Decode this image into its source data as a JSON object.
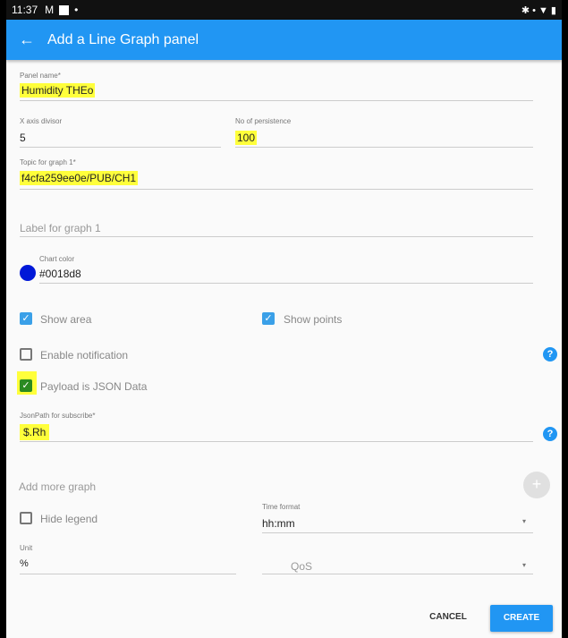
{
  "status": {
    "time": "11:37",
    "mail_glyph": "M",
    "dot": "•",
    "right": "✱ • ▼ ▮"
  },
  "appbar": {
    "back": "←",
    "title": "Add a Line Graph panel"
  },
  "panel_name": {
    "label": "Panel name",
    "required": "*",
    "value": "Humidity THEo"
  },
  "x_axis": {
    "label": "X axis divisor",
    "value": "5"
  },
  "persistence": {
    "label": "No of persistence",
    "value": "100"
  },
  "topic": {
    "label": "Topic for graph 1",
    "required": "*",
    "value": "f4cfa259ee0e/PUB/CH1"
  },
  "graph_label": {
    "placeholder": "Label for graph 1"
  },
  "chart_color": {
    "label": "Chart color",
    "value": "#0018d8",
    "swatch": "#0018d8"
  },
  "checkboxes": {
    "show_area": "Show area",
    "show_points": "Show points",
    "enable_notification": "Enable notification",
    "payload_json": "Payload is JSON Data",
    "hide_legend": "Hide legend"
  },
  "jsonpath": {
    "label": "JsonPath for subscribe",
    "required": "*",
    "value": "$.Rh"
  },
  "add_more": {
    "label": "Add more graph",
    "icon": "+"
  },
  "time_format": {
    "label": "Time format",
    "value": "hh:mm"
  },
  "unit": {
    "label": "Unit",
    "value": "%"
  },
  "qos": {
    "placeholder": "QoS"
  },
  "help_icon": "?",
  "dropdown_arrow": "▾",
  "check_glyph": "✓",
  "actions": {
    "cancel": "CANCEL",
    "create": "CREATE"
  },
  "colors": {
    "accent": "#2196f3",
    "highlight": "#ffff3b"
  }
}
